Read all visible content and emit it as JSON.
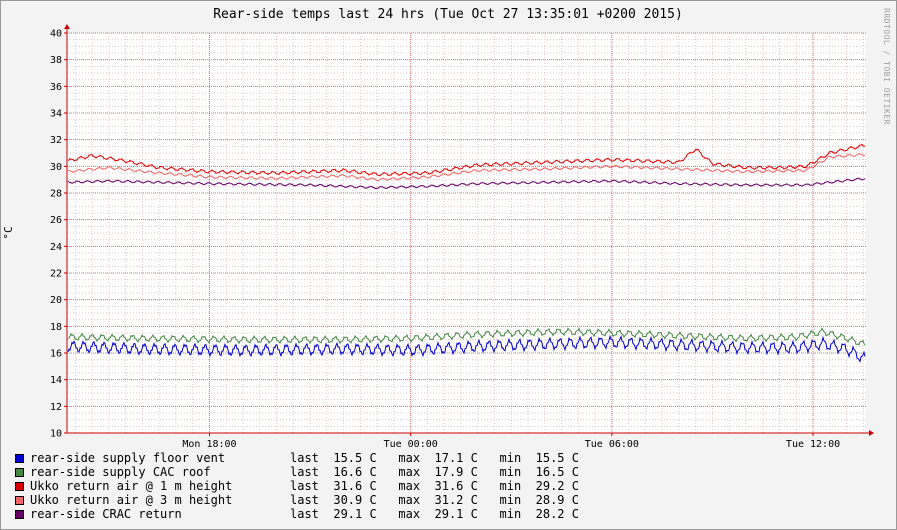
{
  "chart_data": {
    "type": "line",
    "title": "Rear-side temps last 24 hrs (Tue Oct 27 13:35:01 +0200 2015)",
    "ylabel": "°C",
    "watermark": "RRDTOOL / TOBI OETIKER",
    "ylim": [
      10,
      40
    ],
    "yticks": [
      "10",
      "12",
      "14",
      "16",
      "18",
      "20",
      "22",
      "24",
      "26",
      "28",
      "30",
      "32",
      "34",
      "36",
      "38",
      "40"
    ],
    "xrange_hours": [
      13.75,
      37.58
    ],
    "xticks": [
      {
        "label": "Mon 18:00",
        "hour": 18
      },
      {
        "label": "Tue 00:00",
        "hour": 24
      },
      {
        "label": "Tue 06:00",
        "hour": 30
      },
      {
        "label": "Tue 12:00",
        "hour": 36
      }
    ],
    "grid": true,
    "legend_position": "bottom",
    "series": [
      {
        "name": "rear-side supply floor vent",
        "color": "#0000cc",
        "last": "15.5 C",
        "max": "17.1 C",
        "min": "15.5 C",
        "keys": [
          [
            13.75,
            16.5
          ],
          [
            16,
            16.3
          ],
          [
            19,
            16.2
          ],
          [
            22,
            16.3
          ],
          [
            24,
            16.2
          ],
          [
            26,
            16.5
          ],
          [
            28.5,
            16.7
          ],
          [
            30,
            16.8
          ],
          [
            32,
            16.6
          ],
          [
            34,
            16.4
          ],
          [
            35.5,
            16.4
          ],
          [
            36.3,
            16.7
          ],
          [
            37,
            16.3
          ],
          [
            37.58,
            15.5
          ]
        ],
        "amp": 0.35
      },
      {
        "name": "rear-side supply CAC roof",
        "color": "#448844",
        "last": "16.6 C",
        "max": "17.9 C",
        "min": "16.5 C",
        "keys": [
          [
            13.75,
            17.2
          ],
          [
            16,
            17.1
          ],
          [
            19,
            17.0
          ],
          [
            22,
            17.0
          ],
          [
            24,
            17.1
          ],
          [
            26,
            17.4
          ],
          [
            28.5,
            17.6
          ],
          [
            30,
            17.5
          ],
          [
            32,
            17.3
          ],
          [
            34,
            17.1
          ],
          [
            35.5,
            17.2
          ],
          [
            36.3,
            17.6
          ],
          [
            37,
            17.1
          ],
          [
            37.58,
            16.6
          ]
        ],
        "amp": 0.2
      },
      {
        "name": "Ukko return air @ 1 m height",
        "color": "#dd0000",
        "last": "31.6 C",
        "max": "31.6 C",
        "min": "29.2 C",
        "keys": [
          [
            13.75,
            30.4
          ],
          [
            14.5,
            30.8
          ],
          [
            15.5,
            30.4
          ],
          [
            16.5,
            29.9
          ],
          [
            18,
            29.6
          ],
          [
            20,
            29.5
          ],
          [
            22,
            29.7
          ],
          [
            23,
            29.4
          ],
          [
            24.5,
            29.5
          ],
          [
            26,
            30.1
          ],
          [
            28,
            30.3
          ],
          [
            30,
            30.5
          ],
          [
            31,
            30.4
          ],
          [
            32,
            30.3
          ],
          [
            32.5,
            31.3
          ],
          [
            33,
            30.2
          ],
          [
            34,
            29.9
          ],
          [
            35,
            29.9
          ],
          [
            35.8,
            30.0
          ],
          [
            36.5,
            31.0
          ],
          [
            37.58,
            31.6
          ]
        ],
        "amp": 0.1
      },
      {
        "name": "Ukko return air @ 3 m height",
        "color": "#ee6666",
        "last": "30.9 C",
        "max": "31.2 C",
        "min": "28.9 C",
        "keys": [
          [
            13.75,
            29.6
          ],
          [
            15,
            29.9
          ],
          [
            16.5,
            29.5
          ],
          [
            18,
            29.2
          ],
          [
            20,
            29.1
          ],
          [
            22,
            29.3
          ],
          [
            23,
            29.0
          ],
          [
            24.5,
            29.2
          ],
          [
            26,
            29.7
          ],
          [
            28,
            29.8
          ],
          [
            30,
            30.0
          ],
          [
            32,
            29.8
          ],
          [
            34,
            29.6
          ],
          [
            35.8,
            29.7
          ],
          [
            36.5,
            30.7
          ],
          [
            37.58,
            30.9
          ]
        ],
        "amp": 0.08
      },
      {
        "name": "rear-side CRAC return",
        "color": "#660066",
        "last": "29.1 C",
        "max": "29.1 C",
        "min": "28.2 C",
        "keys": [
          [
            13.75,
            28.8
          ],
          [
            15,
            28.9
          ],
          [
            18,
            28.7
          ],
          [
            21,
            28.6
          ],
          [
            23,
            28.4
          ],
          [
            24.5,
            28.5
          ],
          [
            26,
            28.7
          ],
          [
            28,
            28.8
          ],
          [
            30,
            28.9
          ],
          [
            32,
            28.7
          ],
          [
            34,
            28.6
          ],
          [
            35.8,
            28.6
          ],
          [
            36.5,
            28.8
          ],
          [
            37.58,
            29.1
          ]
        ],
        "amp": 0.07
      }
    ]
  },
  "legend": {
    "last_label": "last",
    "max_label": "max",
    "min_label": "min"
  }
}
